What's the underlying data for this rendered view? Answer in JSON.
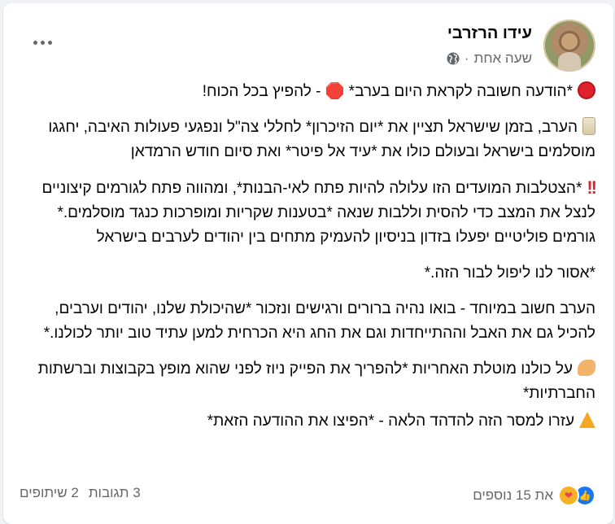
{
  "post": {
    "author": "עידו הרזרבי",
    "timestamp": "שעה אחת",
    "separator": "·",
    "paragraphs": [
      "*הודעה חשובה לקראת היום בערב* 🛑 - להפיץ בכל הכוח!",
      "הערב, בזמן שישראל תציין את *יום הזיכרון* לחללי צה\"ל ונפגעי פעולות האיבה, יחגגו מוסלמים בישראל ובעולם כולו את *עיד אל פיטר* ואת סיום חודש הרמדאן",
      "*הצטלבות המועדים הזו עלולה להיות פתח לאי-הבנות*, ומהווה פתח לגורמים קיצוניים לנצל את המצב כדי להסית וללבות שנאה *בטענות שקריות ומופרכות כנגד מוסלמים.* גורמים פוליטיים יפעלו בזדון בניסיון להעמיק מתחים בין יהודים לערבים בישראל",
      "*אסור לנו ליפול לבור הזה.*",
      "הערב חשוב במיוחד - בואו נהיה ברורים ורגישים ונזכור *שהיכולת שלנו, יהודים וערבים, להכיל גם את האבל וההתייחדות וגם את החג היא הכרחית למען עתיד טוב יותר לכולנו.*",
      "על כולנו מוטלת האחריות *להפריך את הפייק ניוז לפני שהוא מופץ בקבוצות וברשתות החברתיות*",
      "עזרו למסר הזה להדהד הלאה - *הפיצו את ההודעה הזאת*"
    ],
    "icons": {
      "p0": "stop-sign-icon",
      "p1": "scroll-icon",
      "p2": "double-exclamation-icon",
      "p5": "flexed-biceps-icon",
      "p6": "party-popper-icon"
    },
    "reactions_text": "את 15 נוספים",
    "comments": "3 תגובות",
    "shares": "2 שיתופים",
    "colors": {
      "accent": "#1877f2",
      "secondary_text": "#65676b",
      "stop": "#e0212b"
    }
  }
}
